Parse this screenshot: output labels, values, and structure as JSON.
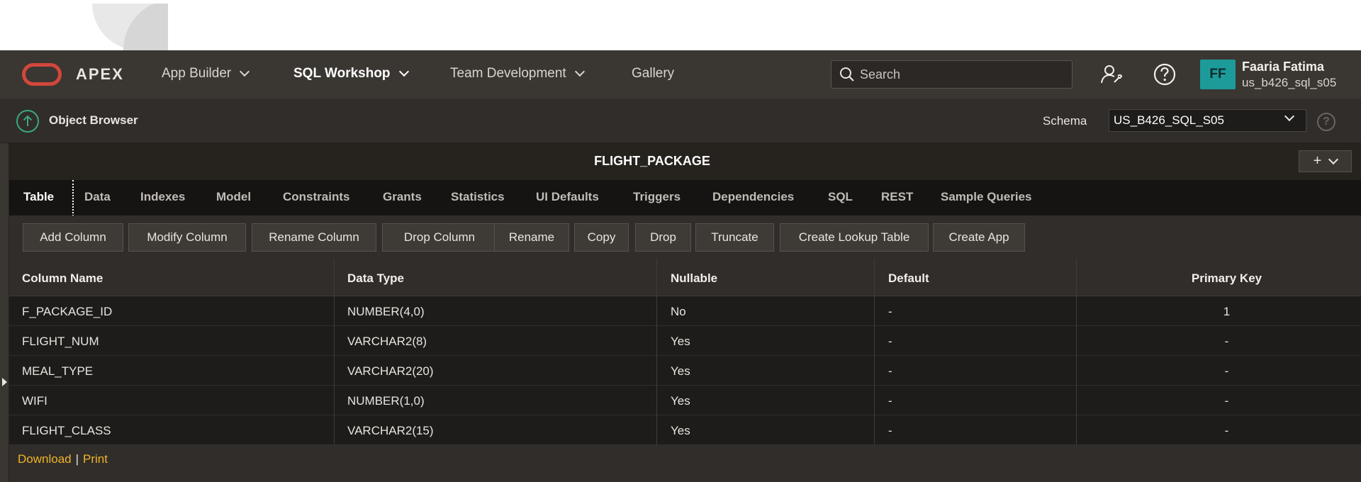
{
  "header": {
    "app_name": "APEX",
    "nav": [
      {
        "label": "App Builder",
        "has_menu": true,
        "active": false
      },
      {
        "label": "SQL Workshop",
        "has_menu": true,
        "active": true
      },
      {
        "label": "Team Development",
        "has_menu": true,
        "active": false
      },
      {
        "label": "Gallery",
        "has_menu": false,
        "active": false
      }
    ],
    "search_placeholder": "Search",
    "user": {
      "initials": "FF",
      "name": "Faaria Fatima",
      "username": "us_b426_sql_s05"
    }
  },
  "subbar": {
    "title": "Object Browser",
    "schema_label": "Schema",
    "schema_value": "US_B426_SQL_S05"
  },
  "table_title": "FLIGHT_PACKAGE",
  "tabs": [
    "Table",
    "Data",
    "Indexes",
    "Model",
    "Constraints",
    "Grants",
    "Statistics",
    "UI Defaults",
    "Triggers",
    "Dependencies",
    "SQL",
    "REST",
    "Sample Queries"
  ],
  "active_tab": "Table",
  "actions": [
    "Add Column",
    "Modify Column",
    "Rename Column",
    "Drop Column",
    "Rename",
    "Copy",
    "Drop",
    "Truncate",
    "Create Lookup Table",
    "Create App"
  ],
  "columns": {
    "headers": [
      "Column Name",
      "Data Type",
      "Nullable",
      "Default",
      "Primary Key"
    ],
    "rows": [
      [
        "F_PACKAGE_ID",
        "NUMBER(4,0)",
        "No",
        "-",
        "1"
      ],
      [
        "FLIGHT_NUM",
        "VARCHAR2(8)",
        "Yes",
        "-",
        "-"
      ],
      [
        "MEAL_TYPE",
        "VARCHAR2(20)",
        "Yes",
        "-",
        "-"
      ],
      [
        "WIFI",
        "NUMBER(1,0)",
        "Yes",
        "-",
        "-"
      ],
      [
        "FLIGHT_CLASS",
        "VARCHAR2(15)",
        "Yes",
        "-",
        "-"
      ]
    ]
  },
  "footer": {
    "download": "Download",
    "separator": "|",
    "print": "Print"
  },
  "colors": {
    "accent": "#d2473b",
    "link": "#f0b429",
    "avatar": "#1d9a9a",
    "header_bg": "#3a3632"
  }
}
